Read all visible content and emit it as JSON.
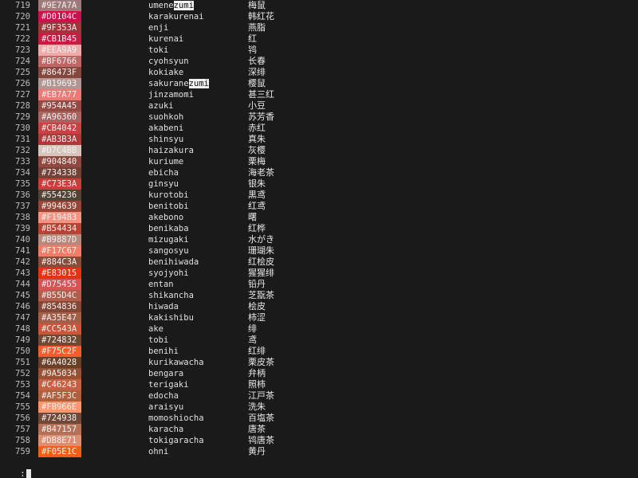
{
  "terminal": {
    "prompt": ":",
    "search_term": "zumi"
  },
  "rows": [
    {
      "num": "719",
      "hex": "#9E7A7A",
      "romaji": "umenezumi",
      "romaji_pre": "umene",
      "romaji_hl": "zumi",
      "kanji": "梅鼠"
    },
    {
      "num": "720",
      "hex": "#D0104C",
      "romaji": "karakurenai",
      "kanji": "韩红花"
    },
    {
      "num": "721",
      "hex": "#9F353A",
      "romaji": "enji",
      "kanji": "燕脂"
    },
    {
      "num": "722",
      "hex": "#CB1B45",
      "romaji": "kurenai",
      "kanji": "红"
    },
    {
      "num": "723",
      "hex": "#EEA9A9",
      "romaji": "toki",
      "kanji": "鸨"
    },
    {
      "num": "724",
      "hex": "#BF6766",
      "romaji": "cyohsyun",
      "kanji": "长春"
    },
    {
      "num": "725",
      "hex": "#86473F",
      "romaji": "kokiake",
      "kanji": "深绯"
    },
    {
      "num": "726",
      "hex": "#B19693",
      "romaji": "sakuranezumi",
      "romaji_pre": "sakurane",
      "romaji_hl": "zumi",
      "kanji": "樱鼠"
    },
    {
      "num": "727",
      "hex": "#EB7A77",
      "romaji": "jinzamomi",
      "kanji": "甚三红"
    },
    {
      "num": "728",
      "hex": "#954A45",
      "romaji": "azuki",
      "kanji": "小豆"
    },
    {
      "num": "729",
      "hex": "#A96360",
      "romaji": "suohkoh",
      "kanji": "苏芳香"
    },
    {
      "num": "730",
      "hex": "#CB4042",
      "romaji": "akabeni",
      "kanji": "赤红"
    },
    {
      "num": "731",
      "hex": "#AB3B3A",
      "romaji": "shinsyu",
      "kanji": "真朱"
    },
    {
      "num": "732",
      "hex": "#D7C4BB",
      "romaji": "haizakura",
      "kanji": "灰樱"
    },
    {
      "num": "733",
      "hex": "#904840",
      "romaji": "kuriume",
      "kanji": "栗梅"
    },
    {
      "num": "734",
      "hex": "#734338",
      "romaji": "ebicha",
      "kanji": "海老茶"
    },
    {
      "num": "735",
      "hex": "#C73E3A",
      "romaji": "ginsyu",
      "kanji": "银朱"
    },
    {
      "num": "736",
      "hex": "#554236",
      "romaji": "kurotobi",
      "kanji": "黒鸢"
    },
    {
      "num": "737",
      "hex": "#994639",
      "romaji": "benitobi",
      "kanji": "红鸢"
    },
    {
      "num": "738",
      "hex": "#F19483",
      "romaji": "akebono",
      "kanji": "曙"
    },
    {
      "num": "739",
      "hex": "#B54434",
      "romaji": "benikaba",
      "kanji": "红桦"
    },
    {
      "num": "740",
      "hex": "#B9887D",
      "romaji": "mizugaki",
      "kanji": "水がき"
    },
    {
      "num": "741",
      "hex": "#F17C67",
      "romaji": "sangosyu",
      "kanji": "珊瑚朱"
    },
    {
      "num": "742",
      "hex": "#884C3A",
      "romaji": "benihiwada",
      "kanji": "红桧皮"
    },
    {
      "num": "743",
      "hex": "#E83015",
      "romaji": "syojyohi",
      "kanji": "猩猩绯"
    },
    {
      "num": "744",
      "hex": "#D75455",
      "romaji": "entan",
      "kanji": "铅丹"
    },
    {
      "num": "745",
      "hex": "#B55D4C",
      "romaji": "shikancha",
      "kanji": "芝翫茶"
    },
    {
      "num": "746",
      "hex": "#854836",
      "romaji": "hiwada",
      "kanji": "桧皮"
    },
    {
      "num": "747",
      "hex": "#A35E47",
      "romaji": "kakishibu",
      "kanji": "柿涩"
    },
    {
      "num": "748",
      "hex": "#CC543A",
      "romaji": "ake",
      "kanji": "绯"
    },
    {
      "num": "749",
      "hex": "#724832",
      "romaji": "tobi",
      "kanji": "鸢"
    },
    {
      "num": "750",
      "hex": "#F75C2F",
      "romaji": "benihi",
      "kanji": "红绯"
    },
    {
      "num": "751",
      "hex": "#6A4028",
      "romaji": "kurikawacha",
      "kanji": "栗皮茶"
    },
    {
      "num": "752",
      "hex": "#9A5034",
      "romaji": "bengara",
      "kanji": "弁柄"
    },
    {
      "num": "753",
      "hex": "#C46243",
      "romaji": "terigaki",
      "kanji": "照柿"
    },
    {
      "num": "754",
      "hex": "#AF5F3C",
      "romaji": "edocha",
      "kanji": "江戸茶"
    },
    {
      "num": "755",
      "hex": "#FB966E",
      "romaji": "araisyu",
      "kanji": "洗朱"
    },
    {
      "num": "756",
      "hex": "#724938",
      "romaji": "momoshiocha",
      "kanji": "百塩茶"
    },
    {
      "num": "757",
      "hex": "#B47157",
      "romaji": "karacha",
      "kanji": "唐茶"
    },
    {
      "num": "758",
      "hex": "#DB8E71",
      "romaji": "tokigaracha",
      "kanji": "鸨唐茶"
    },
    {
      "num": "759",
      "hex": "#F05E1C",
      "romaji": "ohni",
      "kanji": "黄丹"
    }
  ]
}
